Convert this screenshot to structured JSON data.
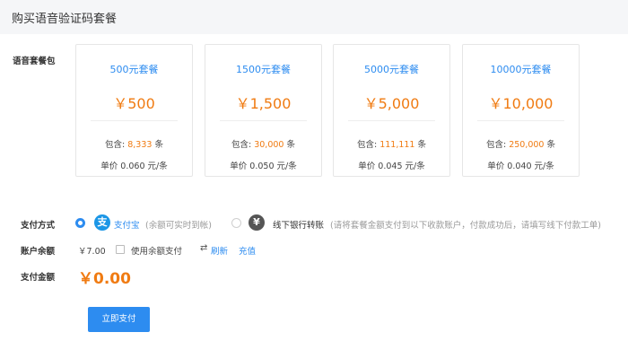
{
  "header": {
    "title": "购买语音验证码套餐"
  },
  "packages": {
    "section_label": "语音套餐包",
    "items": [
      {
        "name": "500元套餐",
        "price": "￥500",
        "contains_label": "包含:",
        "count": "8,333",
        "unit_word": "条",
        "unit_price": "单价 0.060 元/条"
      },
      {
        "name": "1500元套餐",
        "price": "￥1,500",
        "contains_label": "包含:",
        "count": "30,000",
        "unit_word": "条",
        "unit_price": "单价 0.050 元/条"
      },
      {
        "name": "5000元套餐",
        "price": "￥5,000",
        "contains_label": "包含:",
        "count": "111,111",
        "unit_word": "条",
        "unit_price": "单价 0.045 元/条"
      },
      {
        "name": "10000元套餐",
        "price": "￥10,000",
        "contains_label": "包含:",
        "count": "250,000",
        "unit_word": "条",
        "unit_price": "单价 0.040 元/条"
      }
    ]
  },
  "payment": {
    "method_label": "支付方式",
    "alipay": {
      "icon": "alipay-icon",
      "glyph": "支",
      "name": "支付宝",
      "note": "(余额可实时到帐)",
      "selected": true
    },
    "bank": {
      "icon": "yuan-icon",
      "glyph": "¥",
      "name": "线下银行转账",
      "note": "(请将套餐金额支付到以下收款账户，付款成功后，请填写线下付款工单)",
      "selected": false
    },
    "balance_label": "账户余额",
    "balance_value": "￥7.00",
    "use_balance_label": "使用余额支付",
    "refresh_icon": "refresh-icon",
    "refresh_label": "刷新",
    "recharge_label": "充值",
    "amount_label": "支付金额",
    "amount_value": "￥0.00",
    "pay_button": "立即支付"
  },
  "colors": {
    "accent": "#2d8cf0",
    "price": "#f07b12",
    "alipay": "#1b96e6",
    "bank": "#555555"
  }
}
